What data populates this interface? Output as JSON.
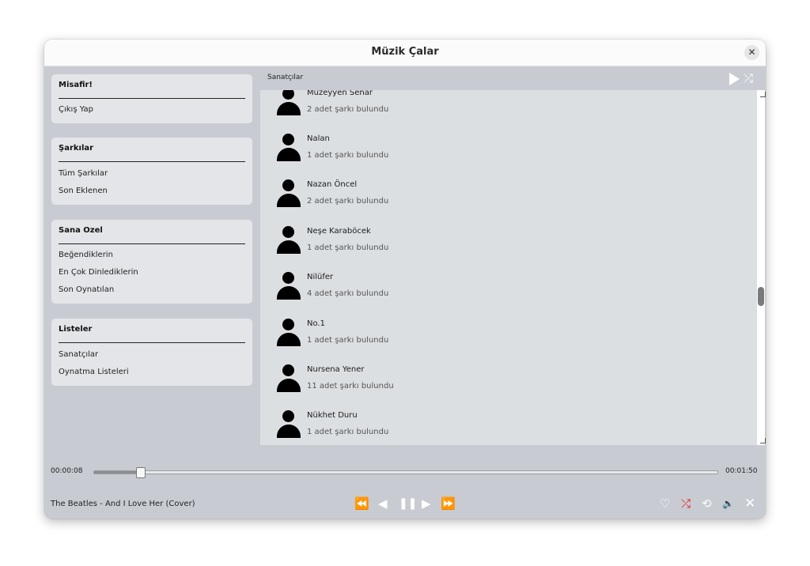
{
  "window": {
    "title": "Müzik Çalar"
  },
  "sidebar": {
    "panels": [
      {
        "title": "Misafir!",
        "items": [
          "Çıkış Yap"
        ]
      },
      {
        "title": "Şarkılar",
        "items": [
          "Tüm Şarkılar",
          "Son Eklenen"
        ]
      },
      {
        "title": "Sana Ozel",
        "items": [
          "Beğendiklerin",
          "En Çok Dinlediklerin",
          "Son Oynatılan"
        ]
      },
      {
        "title": "Listeler",
        "items": [
          "Sanatçılar",
          "Oynatma Listeleri"
        ]
      }
    ]
  },
  "content": {
    "title": "Sanatçılar",
    "artists": [
      {
        "name": "Müzeyyen Senar",
        "count": "2 adet şarkı bulundu"
      },
      {
        "name": "Nalan",
        "count": "1 adet şarkı bulundu"
      },
      {
        "name": "Nazan Öncel",
        "count": "2 adet şarkı bulundu"
      },
      {
        "name": "Neşe Karaböcek",
        "count": "1 adet şarkı bulundu"
      },
      {
        "name": "Nilüfer",
        "count": "4 adet şarkı bulundu"
      },
      {
        "name": "No.1",
        "count": "1 adet şarkı bulundu"
      },
      {
        "name": "Nursena Yener",
        "count": "11 adet şarkı bulundu"
      },
      {
        "name": "Nükhet Duru",
        "count": "1 adet şarkı bulundu"
      }
    ],
    "scroll_position_fraction": 0.59
  },
  "player": {
    "elapsed": "00:00:08",
    "duration": "00:01:50",
    "progress_fraction": 0.073,
    "now_playing": "The Beatles - And I Love Her (Cover)",
    "icons": {
      "rewind": "⏪",
      "prev": "◀",
      "pause": "❚❚",
      "next": "▶",
      "forward": "⏩",
      "like": "♡",
      "shuffle": "⤮",
      "repeat": "⟲",
      "volume": "🔈",
      "close": "✕"
    }
  },
  "colors": {
    "accent_red": "#e8101a",
    "list_bg": "#dcdfe2",
    "panel_bg": "#e3e5e8"
  }
}
